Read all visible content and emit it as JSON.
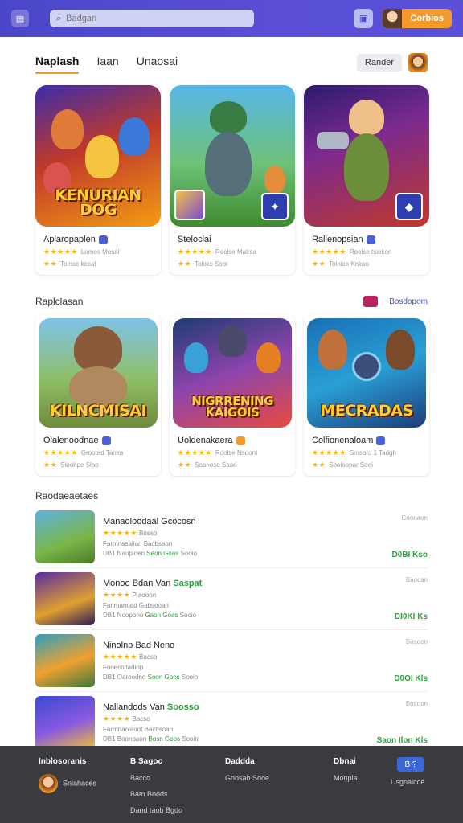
{
  "topbar": {
    "search_placeholder": "Badgan",
    "profile_button": "Corbios",
    "colors": {
      "bar": "#4b46c9",
      "accent": "#f39a2c"
    }
  },
  "tabs": {
    "items": [
      "Naplash",
      "Iaan",
      "Unaosai"
    ],
    "render_button": "Rander"
  },
  "row1": [
    {
      "name": "Aplaropaplen",
      "title_art": "KENURIAN DOG",
      "line1": "Lomos Mosal",
      "line2": "Tolnse kesal"
    },
    {
      "name": "Steloclai",
      "title_art": "",
      "line1": "Roolse Malrsa",
      "line2": "Toloks Sooi"
    },
    {
      "name": "Rallenopsian",
      "title_art": "",
      "line1": "Roolse tsiekon",
      "line2": "Tolnise Knkao"
    }
  ],
  "section2": {
    "heading": "Raplclasan",
    "link": "Bosdopom"
  },
  "row2": [
    {
      "name": "Olalenoodnae",
      "title_art": "KILNCMISAI",
      "line1": "Grooted Tanka",
      "line2": "Sloohpe Sloo"
    },
    {
      "name": "Uoldenakaera",
      "title_art": "NIGRRENING KAIGOIS",
      "line1": "Roolse Nsoont",
      "line2": "Soanose Saod"
    },
    {
      "name": "Colfionenaloam",
      "title_art": "MECRADAS",
      "line1": "Smsord 1 Tadgh",
      "line2": "Sooloopar Sooi"
    }
  ],
  "list": {
    "heading": "Raodaeaetaes",
    "items": [
      {
        "title": "Manaoloodaal Gcocosn",
        "highlight": "",
        "rating": "Bosso",
        "line2": "Farmnasalian Bacbsaon",
        "line3a": "DB1 Nauploen",
        "line3b": "Seon Goas",
        "line3c": "Sooio",
        "status": "Coonaon",
        "price": "D0BI Kso"
      },
      {
        "title": "Monoo Bdan Van",
        "highlight": "Saspat",
        "rating": "P aooon",
        "line2": "Fanmanoad Gabsooan",
        "line3a": "DB1 Noopono",
        "line3b": "Gaon Goas",
        "line3c": "Sooio",
        "status": "Baocan",
        "price": "DI0KI Ks"
      },
      {
        "title": "Ninolnp Bad Neno",
        "highlight": "",
        "rating": "Bacso",
        "line2": "Fooecoltadiop",
        "line3a": "DB1 Oaroodno",
        "line3b": "Soon Goos",
        "line3c": "Sooio",
        "status": "Bosoon",
        "price": "D0OI Kls"
      },
      {
        "title": "Nallandods Van",
        "highlight": "Soosso",
        "rating": "Bacso",
        "line2": "Farmnaolaoot Bacbsoan",
        "line3a": "DB1 Boonpaon",
        "line3b": "Bosn Goos",
        "line3c": "Sooio",
        "status": "Bosoon",
        "price": "Saon Ilon Kls"
      }
    ]
  },
  "footer": {
    "brand": "Inblosoranis",
    "user": "Sniahaces",
    "col2": {
      "head": "B Sagoo",
      "items": [
        "Bacco",
        "Bam Boods",
        "Dand taob Bgdo"
      ]
    },
    "col3": {
      "head": "Daddda",
      "items": [
        "Gnosab Sooe"
      ]
    },
    "col4": {
      "head": "Dbnai",
      "items": [
        "Monpla"
      ]
    },
    "col5": {
      "button": "B ?",
      "items": [
        "Usgnalcoe"
      ]
    }
  }
}
